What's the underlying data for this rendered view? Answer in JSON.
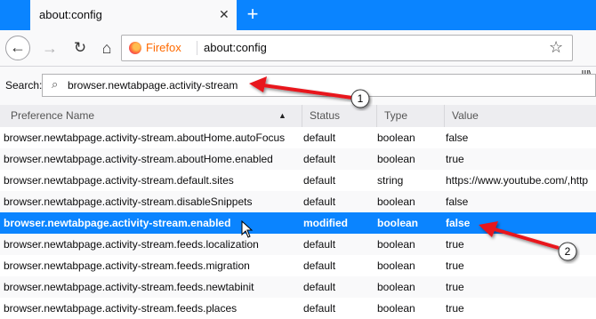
{
  "tab": {
    "title": "about:config"
  },
  "urlbar": {
    "identity": "Firefox",
    "url": "about:config"
  },
  "search": {
    "label": "Search:",
    "value": "browser.newtabpage.activity-stream"
  },
  "columns": [
    "Preference Name",
    "Status",
    "Type",
    "Value"
  ],
  "rows": [
    {
      "name": "browser.newtabpage.activity-stream.aboutHome.autoFocus",
      "status": "default",
      "type": "boolean",
      "value": "false"
    },
    {
      "name": "browser.newtabpage.activity-stream.aboutHome.enabled",
      "status": "default",
      "type": "boolean",
      "value": "true"
    },
    {
      "name": "browser.newtabpage.activity-stream.default.sites",
      "status": "default",
      "type": "string",
      "value": "https://www.youtube.com/,http"
    },
    {
      "name": "browser.newtabpage.activity-stream.disableSnippets",
      "status": "default",
      "type": "boolean",
      "value": "false"
    },
    {
      "name": "browser.newtabpage.activity-stream.enabled",
      "status": "modified",
      "type": "boolean",
      "value": "false"
    },
    {
      "name": "browser.newtabpage.activity-stream.feeds.localization",
      "status": "default",
      "type": "boolean",
      "value": "true"
    },
    {
      "name": "browser.newtabpage.activity-stream.feeds.migration",
      "status": "default",
      "type": "boolean",
      "value": "true"
    },
    {
      "name": "browser.newtabpage.activity-stream.feeds.newtabinit",
      "status": "default",
      "type": "boolean",
      "value": "true"
    },
    {
      "name": "browser.newtabpage.activity-stream.feeds.places",
      "status": "default",
      "type": "boolean",
      "value": "true"
    }
  ],
  "annotations": {
    "callout_1": "1",
    "callout_2": "2"
  },
  "colors": {
    "accent": "#0a84ff",
    "arrow": "#e8141b"
  }
}
